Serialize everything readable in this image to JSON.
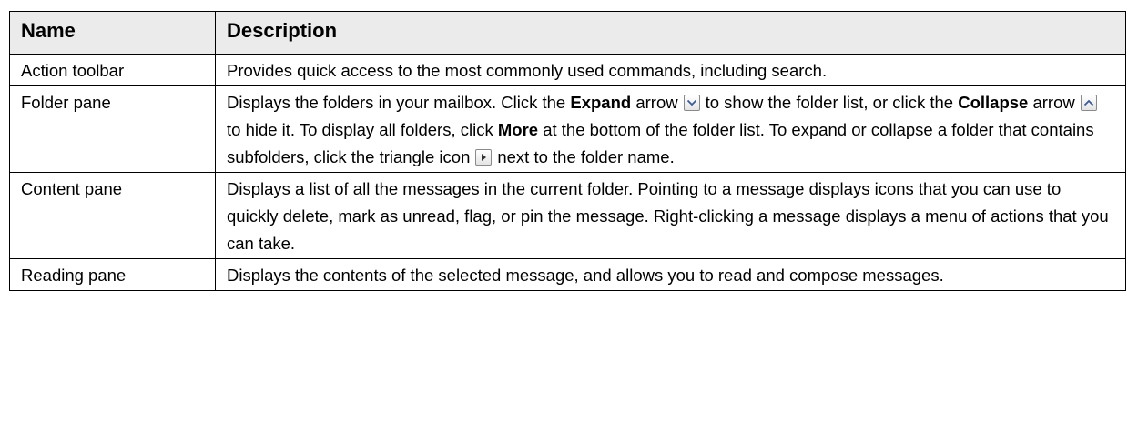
{
  "headers": {
    "name": "Name",
    "description": "Description"
  },
  "rows": [
    {
      "name": "Action toolbar",
      "parts": {
        "t1": "Provides quick access to the most commonly used commands, including search."
      }
    },
    {
      "name": "Folder pane",
      "parts": {
        "t1": "Displays the folders in your mailbox. Click the ",
        "b1": "Expand",
        "t2": " arrow",
        "icon1": "expand-arrow-icon",
        "t3": "to show the folder list, or click the ",
        "b2": "Collapse",
        "t4": " arrow",
        "icon2": "collapse-arrow-icon",
        "t5": "to hide it. To display all folders, click ",
        "b3": "More",
        "t6": " at the bottom of the folder list. To expand or collapse a folder that contains subfolders, click the triangle icon",
        "icon3": "triangle-icon",
        "t7": "next to the folder name."
      }
    },
    {
      "name": "Content pane",
      "parts": {
        "t1": "Displays a list of all the messages in the current folder. Pointing to a message displays icons that you can use to quickly delete, mark as unread, flag, or pin the message. Right-clicking a message displays a menu of actions that you can take."
      }
    },
    {
      "name": "Reading pane",
      "parts": {
        "t1": "Displays the contents of the selected message, and allows you to read and compose messages."
      }
    }
  ]
}
